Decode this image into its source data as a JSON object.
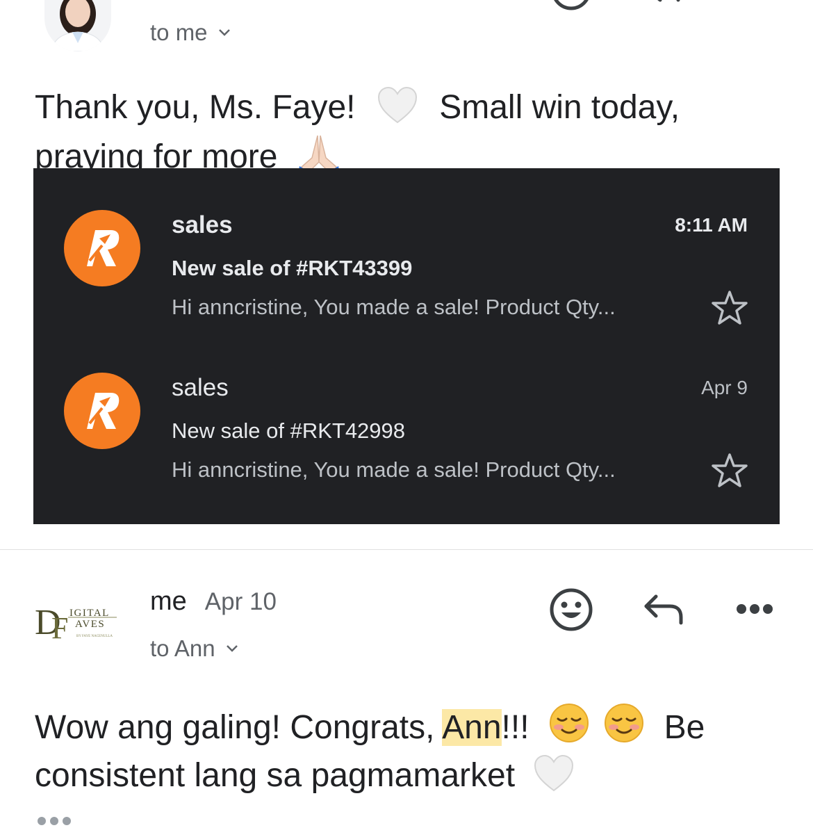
{
  "top_message": {
    "to_label": "to me",
    "body_line1_a": "Thank you, Ms. Faye!",
    "body_line1_b": "Small win today,",
    "body_line2": "praying for more"
  },
  "inbox_screenshot": {
    "emails": [
      {
        "sender": "sales",
        "time": "8:11 AM",
        "subject": "New sale of #RKT43399",
        "snippet": "Hi anncristine, You made a sale! Product Qty...",
        "unread": true,
        "logo_letter": "R"
      },
      {
        "sender": "sales",
        "time": "Apr 9",
        "subject": "New sale of #RKT42998",
        "snippet": "Hi anncristine, You made a sale! Product Qty...",
        "unread": false,
        "logo_letter": "R"
      }
    ],
    "logo_color": "#F57C22"
  },
  "reply_message": {
    "sender": "me",
    "date": "Apr 10",
    "to_label": "to Ann",
    "logo_text_top": "IGITAL",
    "logo_text_bottom": "AVES",
    "logo_tagline": "BY FAYE NACENULLA",
    "body_a": "Wow ang galing! Congrats, ",
    "body_highlight": "Ann",
    "body_b": "!!!",
    "body_c": "Be",
    "body_line2": "consistent lang sa pagmamarket"
  },
  "icons": {
    "emoji_react": "smiley-icon",
    "reply": "reply-icon",
    "more": "more-icon",
    "heart": "white-heart-emoji",
    "pray": "folded-hands-emoji",
    "blush": "smiling-face-emoji",
    "star": "star-icon"
  }
}
